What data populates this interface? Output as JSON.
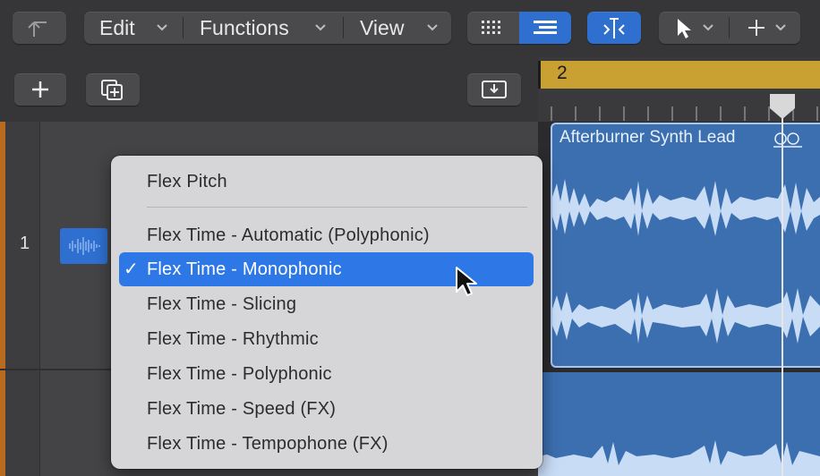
{
  "toolbar": {
    "edit_label": "Edit",
    "functions_label": "Functions",
    "view_label": "View"
  },
  "track": {
    "number": "1"
  },
  "ruler": {
    "bar_number": "2"
  },
  "region": {
    "title": "Afterburner Synth Lead"
  },
  "menu": {
    "items": [
      {
        "label": "Flex Pitch",
        "checked": false
      },
      {
        "label": "Flex Time - Automatic (Polyphonic)",
        "checked": false
      },
      {
        "label": "Flex Time - Monophonic",
        "checked": true
      },
      {
        "label": "Flex Time - Slicing",
        "checked": false
      },
      {
        "label": "Flex Time - Rhythmic",
        "checked": false
      },
      {
        "label": "Flex Time - Polyphonic",
        "checked": false
      },
      {
        "label": "Flex Time - Speed (FX)",
        "checked": false
      },
      {
        "label": "Flex Time - Tempophone (FX)",
        "checked": false
      }
    ],
    "checkmark": "✓"
  },
  "colors": {
    "accent": "#2d78e6",
    "region": "#3c6fb0",
    "ruler": "#c9a032",
    "track_edge": "#b86b1e"
  }
}
